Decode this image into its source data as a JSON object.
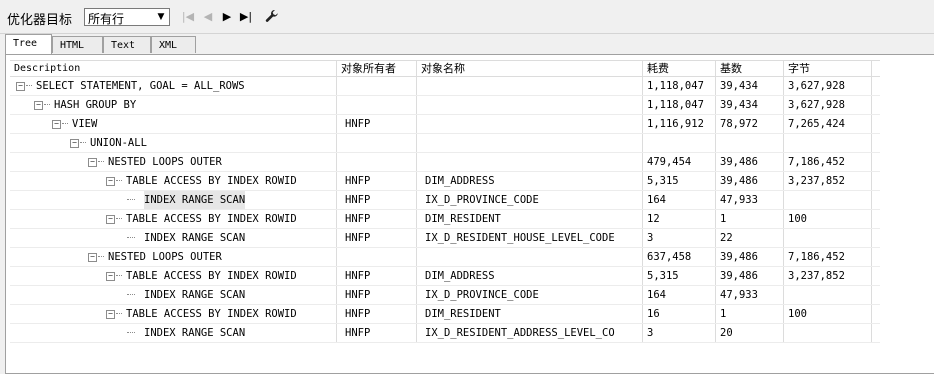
{
  "toolbar": {
    "label": "优化器目标",
    "select_value": "所有行",
    "nav": {
      "first": "|◀",
      "prev": "◀",
      "next": "▶",
      "last": "▶|"
    },
    "settings_icon": "wrench-icon"
  },
  "tabs": [
    "Tree",
    "HTML",
    "Text",
    "XML"
  ],
  "columns": {
    "description": "Description",
    "owner": "对象所有者",
    "object": "对象名称",
    "cost": "耗费",
    "cardinality": "基数",
    "bytes": "字节"
  },
  "rows": [
    {
      "desc": "SELECT STATEMENT, GOAL = ALL_ROWS",
      "owner": "",
      "object": "",
      "cost": "1,118,047",
      "card": "39,434",
      "bytes": "3,627,928"
    },
    {
      "desc": "HASH GROUP BY",
      "owner": "",
      "object": "",
      "cost": "1,118,047",
      "card": "39,434",
      "bytes": "3,627,928"
    },
    {
      "desc": "VIEW",
      "owner": "HNFP",
      "object": "",
      "cost": "1,116,912",
      "card": "78,972",
      "bytes": "7,265,424"
    },
    {
      "desc": "UNION-ALL",
      "owner": "",
      "object": "",
      "cost": "",
      "card": "",
      "bytes": ""
    },
    {
      "desc": "NESTED LOOPS OUTER",
      "owner": "",
      "object": "",
      "cost": "479,454",
      "card": "39,486",
      "bytes": "7,186,452"
    },
    {
      "desc": "TABLE ACCESS BY INDEX ROWID",
      "owner": "HNFP",
      "object": "DIM_ADDRESS",
      "cost": "5,315",
      "card": "39,486",
      "bytes": "3,237,852"
    },
    {
      "desc": "INDEX RANGE SCAN",
      "owner": "HNFP",
      "object": "IX_D_PROVINCE_CODE",
      "cost": "164",
      "card": "47,933",
      "bytes": ""
    },
    {
      "desc": "TABLE ACCESS BY INDEX ROWID",
      "owner": "HNFP",
      "object": "DIM_RESIDENT",
      "cost": "12",
      "card": "1",
      "bytes": "100"
    },
    {
      "desc": "INDEX RANGE SCAN",
      "owner": "HNFP",
      "object": "IX_D_RESIDENT_HOUSE_LEVEL_CODE",
      "cost": "3",
      "card": "22",
      "bytes": ""
    },
    {
      "desc": "NESTED LOOPS OUTER",
      "owner": "",
      "object": "",
      "cost": "637,458",
      "card": "39,486",
      "bytes": "7,186,452"
    },
    {
      "desc": "TABLE ACCESS BY INDEX ROWID",
      "owner": "HNFP",
      "object": "DIM_ADDRESS",
      "cost": "5,315",
      "card": "39,486",
      "bytes": "3,237,852"
    },
    {
      "desc": "INDEX RANGE SCAN",
      "owner": "HNFP",
      "object": "IX_D_PROVINCE_CODE",
      "cost": "164",
      "card": "47,933",
      "bytes": ""
    },
    {
      "desc": "TABLE ACCESS BY INDEX ROWID",
      "owner": "HNFP",
      "object": "DIM_RESIDENT",
      "cost": "16",
      "card": "1",
      "bytes": "100"
    },
    {
      "desc": "INDEX RANGE SCAN",
      "owner": "HNFP",
      "object": "IX_D_RESIDENT_ADDRESS_LEVEL_CO",
      "cost": "3",
      "card": "20",
      "bytes": ""
    }
  ]
}
